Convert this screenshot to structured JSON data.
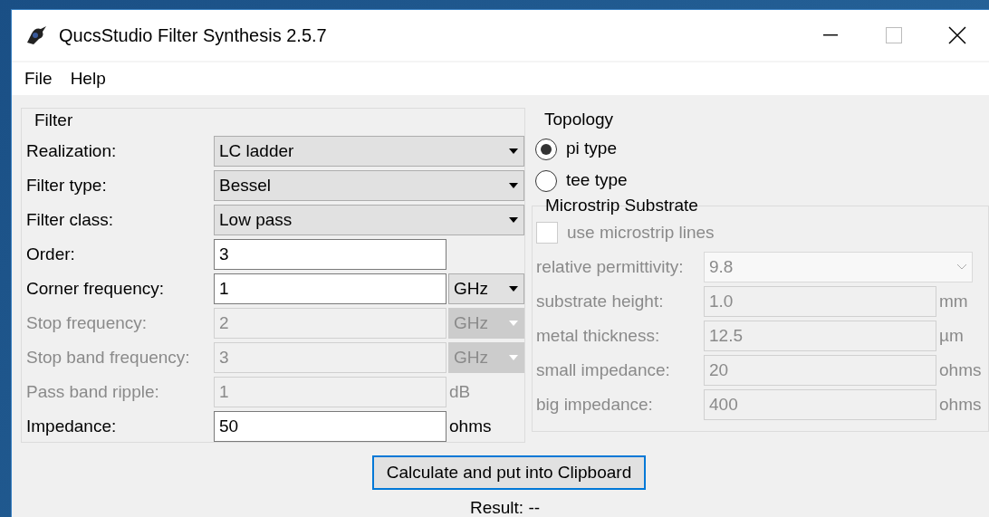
{
  "window": {
    "title": "QucsStudio Filter Synthesis 2.5.7"
  },
  "menu": [
    "File",
    "Help"
  ],
  "filter": {
    "title": "Filter",
    "rows": [
      {
        "label": "Realization:",
        "kind": "dropdown",
        "value": "LC ladder",
        "disabled": false
      },
      {
        "label": "Filter type:",
        "kind": "dropdown",
        "value": "Bessel",
        "disabled": false
      },
      {
        "label": "Filter class:",
        "kind": "dropdown",
        "value": "Low pass",
        "disabled": false
      },
      {
        "label": "Order:",
        "kind": "field",
        "value": "3",
        "disabled": false
      },
      {
        "label": "Corner frequency:",
        "kind": "field",
        "value": "1",
        "disabled": false,
        "unit": {
          "kind": "dropdown",
          "text": "GHz"
        }
      },
      {
        "label": "Stop frequency:",
        "kind": "field",
        "value": "2",
        "disabled": true,
        "unit": {
          "kind": "dropdown",
          "text": "GHz"
        }
      },
      {
        "label": "Stop band frequency:",
        "kind": "field",
        "value": "3",
        "disabled": true,
        "unit": {
          "kind": "dropdown",
          "text": "GHz"
        }
      },
      {
        "label": "Pass band ripple:",
        "kind": "field",
        "value": "1",
        "disabled": true,
        "unit": {
          "kind": "text",
          "text": "dB"
        }
      },
      {
        "label": "Impedance:",
        "kind": "field",
        "value": "50",
        "disabled": false,
        "unit": {
          "kind": "text",
          "text": "ohms"
        }
      }
    ]
  },
  "topology": {
    "title": "Topology",
    "options": [
      {
        "label": "pi type",
        "selected": true
      },
      {
        "label": "tee type",
        "selected": false
      }
    ]
  },
  "microstrip": {
    "title": "Microstrip Substrate",
    "checkbox": {
      "label": "use microstrip lines",
      "checked": false,
      "disabled": true
    },
    "rows": [
      {
        "label": "relative permittivity:",
        "kind": "dropdown",
        "value": "9.8",
        "disabled": true
      },
      {
        "label": "substrate height:",
        "kind": "field",
        "value": "1.0",
        "disabled": true,
        "unit": {
          "kind": "text",
          "text": "mm"
        }
      },
      {
        "label": "metal thickness:",
        "kind": "field",
        "value": "12.5",
        "disabled": true,
        "unit": {
          "kind": "text",
          "text": "µm"
        }
      },
      {
        "label": "small impedance:",
        "kind": "field",
        "value": "20",
        "disabled": true,
        "unit": {
          "kind": "text",
          "text": "ohms"
        }
      },
      {
        "label": "big impedance:",
        "kind": "field",
        "value": "400",
        "disabled": true,
        "unit": {
          "kind": "text",
          "text": "ohms"
        }
      }
    ]
  },
  "button": "Calculate and put into Clipboard",
  "result": "Result: --"
}
